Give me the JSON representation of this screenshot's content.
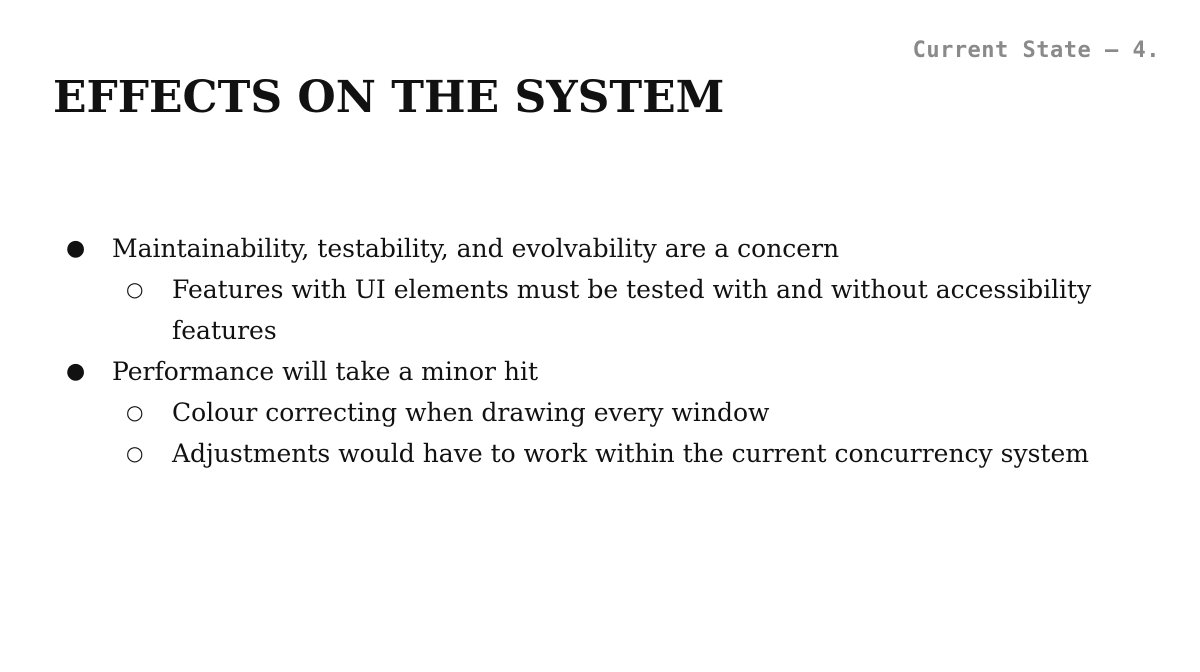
{
  "slide": {
    "section_tag": "Current State — 4.",
    "title": "EFFECTS ON THE SYSTEM",
    "bullets": [
      {
        "text": "Maintainability, testability, and evolvability are a concern",
        "children": [
          "Features with UI elements must be tested with and without accessibility features"
        ]
      },
      {
        "text": "Performance will take a minor hit",
        "children": [
          "Colour correcting when drawing every window",
          "Adjustments would have to work within the current concurrency system"
        ]
      }
    ],
    "markers": {
      "level_1": "●",
      "level_2": "○"
    }
  }
}
